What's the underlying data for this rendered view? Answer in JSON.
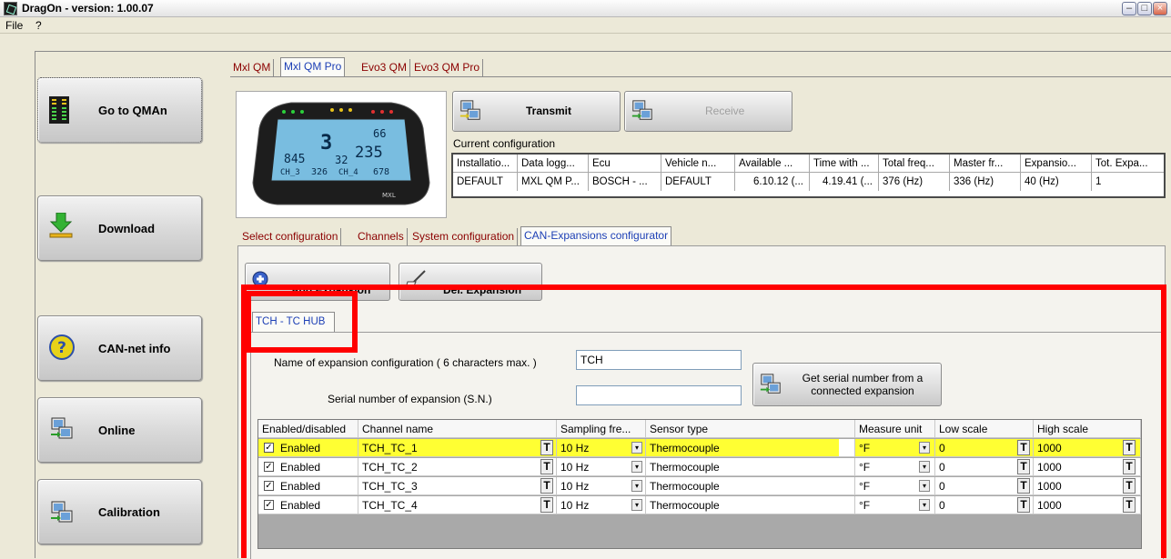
{
  "window": {
    "title": "DragOn  - version: 1.00.07"
  },
  "menu": [
    "File",
    "?"
  ],
  "sidebar": {
    "buttons": [
      {
        "label": "Go to QMAn",
        "icon": "led-bar-icon"
      },
      {
        "label": "Download",
        "icon": "download-arrow-icon"
      },
      {
        "label": "CAN-net info",
        "icon": "help-question-icon"
      },
      {
        "label": "Online",
        "icon": "computer-network-icon"
      },
      {
        "label": "Calibration",
        "icon": "computer-network-icon"
      }
    ]
  },
  "device_tabs": [
    "Mxl QM",
    "Mxl QM Pro",
    "Evo3 QM",
    "Evo3 QM Pro"
  ],
  "device_tabs_active": 1,
  "dash": {
    "rpm": "845",
    "gear": "3",
    "speed": "235",
    "aux1": "32",
    "ch3": "CH_3",
    "val3": "326",
    "ch4": "CH_4",
    "val4": "678",
    "top": "66",
    "brand": "MXL"
  },
  "actions": {
    "transmit": "Transmit",
    "receive": "Receive"
  },
  "current_config": {
    "label": "Current configuration",
    "columns": [
      "Installatio...",
      "Data logg...",
      "Ecu",
      "Vehicle n...",
      "Available ...",
      "Time with ...",
      "Total freq...",
      "Master fr...",
      "Expansio...",
      "Tot. Expa..."
    ],
    "row": [
      "DEFAULT",
      "MXL QM P...",
      "BOSCH - ...",
      "DEFAULT",
      "6.10.12 (...",
      "4.19.41 (...",
      "376 (Hz)",
      "336 (Hz)",
      "40 (Hz)",
      "1"
    ]
  },
  "config_tabs": [
    "Select configuration",
    "Channels",
    "System configuration",
    "CAN-Expansions configurator"
  ],
  "config_tabs_active": 3,
  "expansion_buttons": {
    "add": "Add Expansion",
    "del": "Del. Expansion"
  },
  "expansion_tabs": [
    "TCH - TC HUB"
  ],
  "expansion": {
    "name_label": "Name of expansion configuration ( 6 characters max. )",
    "name_value": "TCH",
    "serial_label": "Serial number of expansion (S.N.)",
    "serial_value": "",
    "get_serial": {
      "line1": "Get serial number from a",
      "line2": "connected expansion"
    }
  },
  "grid": {
    "columns": [
      "Enabled/disabled",
      "Channel name",
      "Sampling fre...",
      "Sensor type",
      "Measure unit",
      "Low scale",
      "High scale"
    ],
    "rows": [
      {
        "enabled": "Enabled",
        "checked": "✓",
        "name": "TCH_TC_1",
        "sampling": "10 Hz",
        "sensor": "Thermocouple",
        "unit": "°F",
        "low": "0",
        "high": "1000",
        "highlight": true
      },
      {
        "enabled": "Enabled",
        "checked": "✓",
        "name": "TCH_TC_2",
        "sampling": "10 Hz",
        "sensor": "Thermocouple",
        "unit": "°F",
        "low": "0",
        "high": "1000",
        "highlight": false
      },
      {
        "enabled": "Enabled",
        "checked": "✓",
        "name": "TCH_TC_3",
        "sampling": "10 Hz",
        "sensor": "Thermocouple",
        "unit": "°F",
        "low": "0",
        "high": "1000",
        "highlight": false
      },
      {
        "enabled": "Enabled",
        "checked": "✓",
        "name": "TCH_TC_4",
        "sampling": "10 Hz",
        "sensor": "Thermocouple",
        "unit": "°F",
        "low": "0",
        "high": "1000",
        "highlight": false
      }
    ],
    "t_button": "T",
    "dropdown_glyph": "▾"
  },
  "colors": {
    "highlight_row": "#ffff33",
    "annotation": "#ff0000",
    "active_tab": "#1c3fb5",
    "inactive_tab": "#8b0000"
  }
}
